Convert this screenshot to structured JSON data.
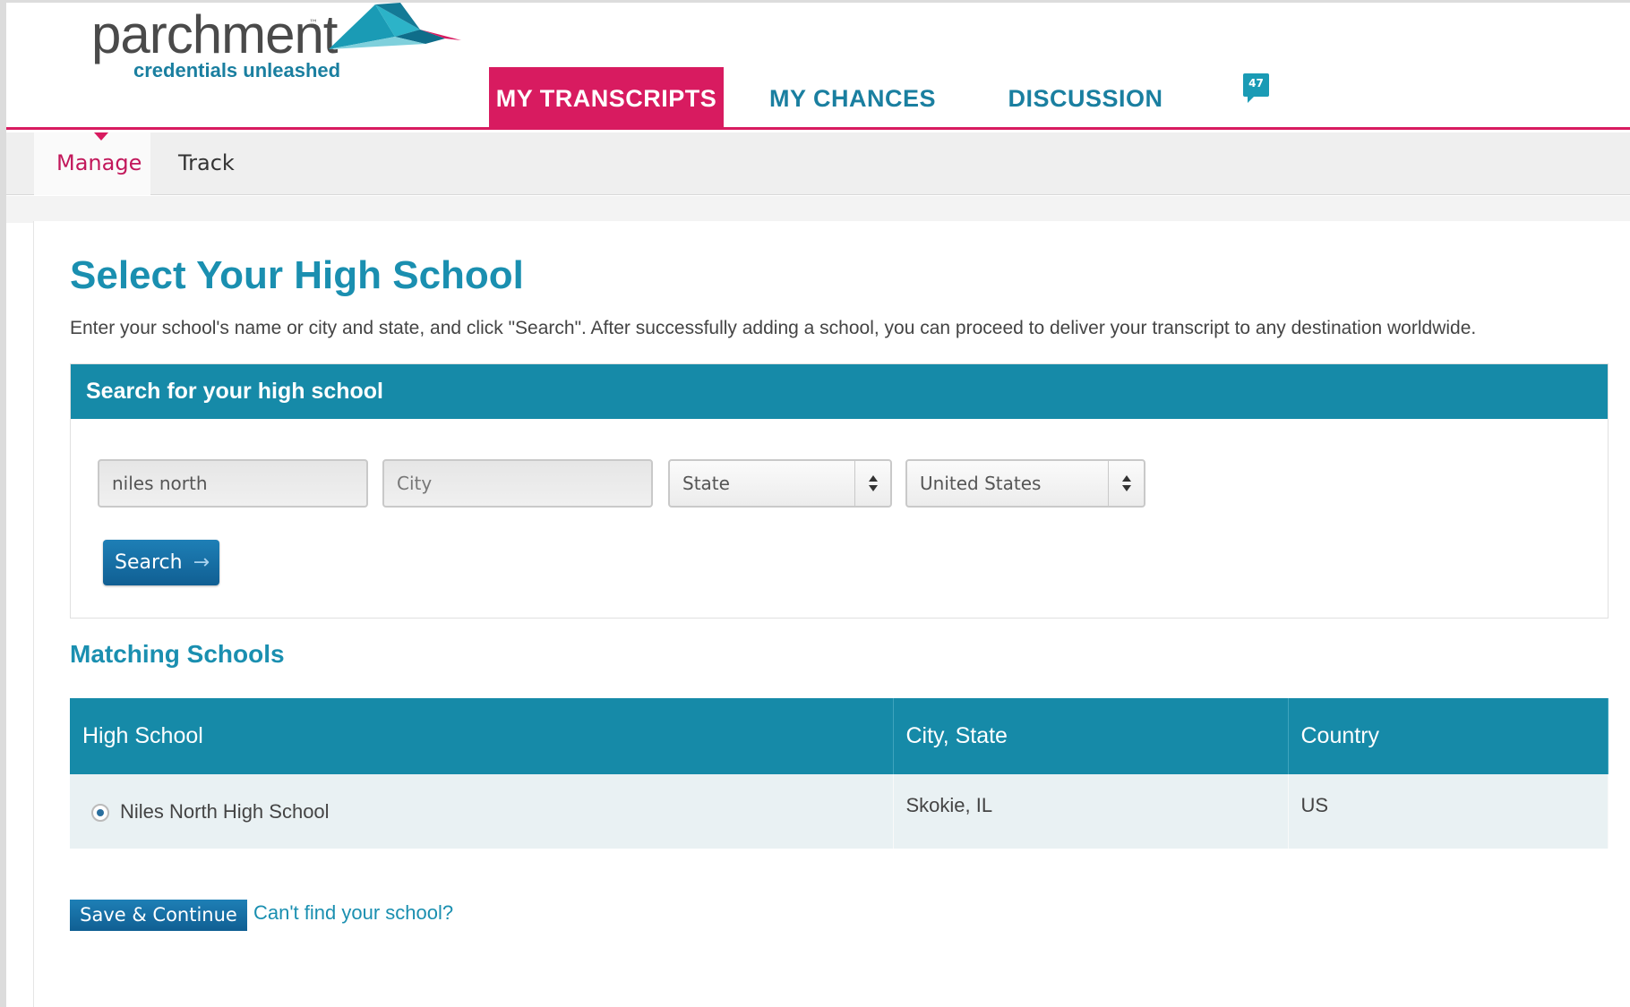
{
  "brand": {
    "name": "parchment",
    "trademark": "™",
    "tagline": "credentials unleashed",
    "primary_color": "#d81b60",
    "accent_color": "#168aa8"
  },
  "nav": {
    "home_icon": "home-icon",
    "tabs": [
      {
        "label": "MY TRANSCRIPTS",
        "active": true
      },
      {
        "label": "MY CHANCES",
        "active": false
      },
      {
        "label": "DISCUSSION",
        "active": false
      }
    ],
    "discussion_badge": "47"
  },
  "subnav": {
    "tabs": [
      {
        "label": "Manage",
        "active": true
      },
      {
        "label": "Track",
        "active": false
      }
    ]
  },
  "main": {
    "title": "Select Your High School",
    "intro": "Enter your school's name or city and state, and click \"Search\". After successfully adding a school, you can proceed to deliver your transcript to any destination worldwide."
  },
  "search": {
    "panel_title": "Search for your high school",
    "school_value": "niles north",
    "city_placeholder": "City",
    "state_value": "State",
    "country_value": "United States",
    "button_label": "Search",
    "button_arrow": "→"
  },
  "results": {
    "title": "Matching Schools",
    "columns": [
      "High School",
      "City, State",
      "Country"
    ],
    "rows": [
      {
        "school": "Niles North High School",
        "city_state": "Skokie, IL",
        "country": "US",
        "selected": true
      }
    ]
  },
  "footer": {
    "save_label": "Save & Continue",
    "cant_find_label": "Can't find your school?"
  }
}
